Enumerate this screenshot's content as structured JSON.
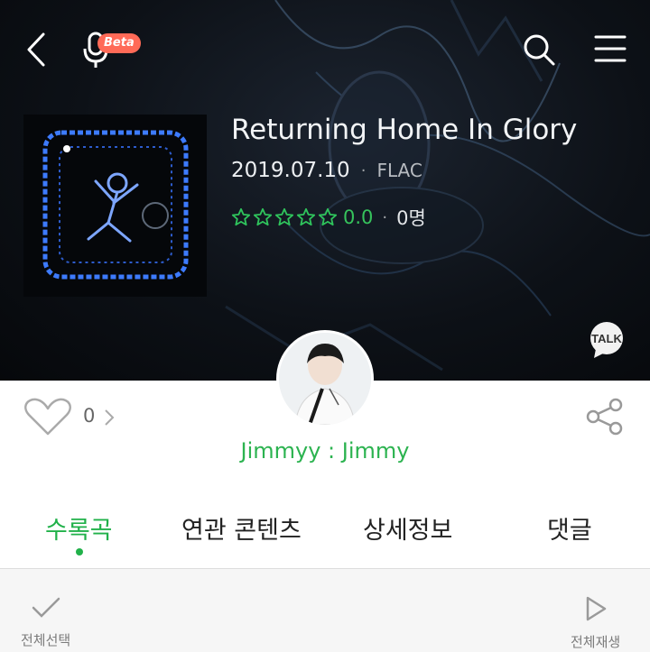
{
  "header": {
    "beta_badge": "Beta",
    "back_icon": "chevron-left-icon",
    "voice_icon": "microphone-icon",
    "search_icon": "search-icon",
    "menu_icon": "hamburger-menu-icon"
  },
  "album": {
    "title": "Returning Home In Glory",
    "release_date": "2019.07.10",
    "separator": "·",
    "format": "FLAC",
    "rating_score": "0.0",
    "rating_count": "0명",
    "stars": 0,
    "talk_label": "TALK"
  },
  "social": {
    "like_count": "0",
    "heart_icon": "heart-outline-icon",
    "share_icon": "share-icon"
  },
  "artist": {
    "label": "Jimmyy : Jimmy"
  },
  "tabs": [
    {
      "label": "수록곡",
      "active": true
    },
    {
      "label": "연관 콘텐츠",
      "active": false
    },
    {
      "label": "상세정보",
      "active": false
    },
    {
      "label": "댓글",
      "active": false
    }
  ],
  "toolbar": {
    "select_all": "전체선택",
    "play_all": "전체재생"
  },
  "colors": {
    "accent": "#21b14a",
    "beta": "#ff6a57",
    "hero_background": "#0d1117"
  }
}
